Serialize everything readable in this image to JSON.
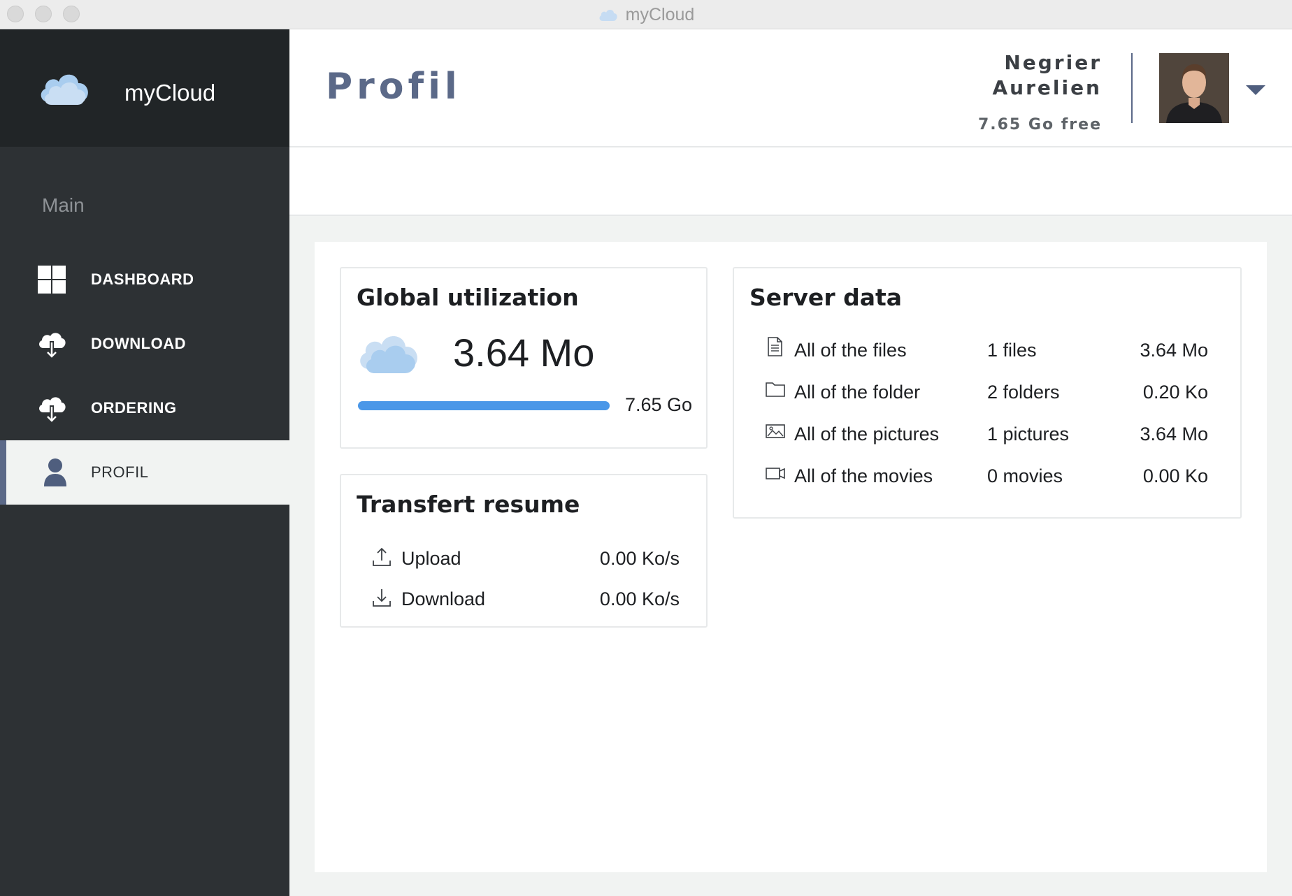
{
  "window": {
    "title": "myCloud"
  },
  "sidebar": {
    "brand": "myCloud",
    "section": "Main",
    "items": [
      {
        "label": "DASHBOARD",
        "icon": "grid-icon"
      },
      {
        "label": "DOWNLOAD",
        "icon": "cloud-download-icon"
      },
      {
        "label": "ORDERING",
        "icon": "cloud-download-icon"
      },
      {
        "label": "PROFIL",
        "icon": "user-icon",
        "active": true
      }
    ]
  },
  "header": {
    "title": "Profil",
    "user_name": "Negrier Aurelien",
    "free_space": "7.65 Go free"
  },
  "global": {
    "title": "Global utilization",
    "used": "3.64 Mo",
    "total": "7.65 Go",
    "progress": 1.0
  },
  "transfer": {
    "title": "Transfert resume",
    "rows": [
      {
        "label": "Upload",
        "value": "0.00 Ko/s",
        "icon": "upload-icon"
      },
      {
        "label": "Download",
        "value": "0.00 Ko/s",
        "icon": "download-icon"
      }
    ]
  },
  "server": {
    "title": "Server data",
    "rows": [
      {
        "label": "All of the files",
        "count": "1 files",
        "size": "3.64 Mo",
        "icon": "file-icon"
      },
      {
        "label": "All of the folder",
        "count": "2 folders",
        "size": "0.20 Ko",
        "icon": "folder-icon"
      },
      {
        "label": "All of the pictures",
        "count": "1 pictures",
        "size": "3.64 Mo",
        "icon": "picture-icon"
      },
      {
        "label": "All of the movies",
        "count": "0 movies",
        "size": "0.00 Ko",
        "icon": "video-icon"
      }
    ]
  },
  "colors": {
    "sidebar_bg": "#2d3134",
    "brand_bg": "#212527",
    "accent": "#5b6988",
    "progress": "#4a97e8"
  }
}
